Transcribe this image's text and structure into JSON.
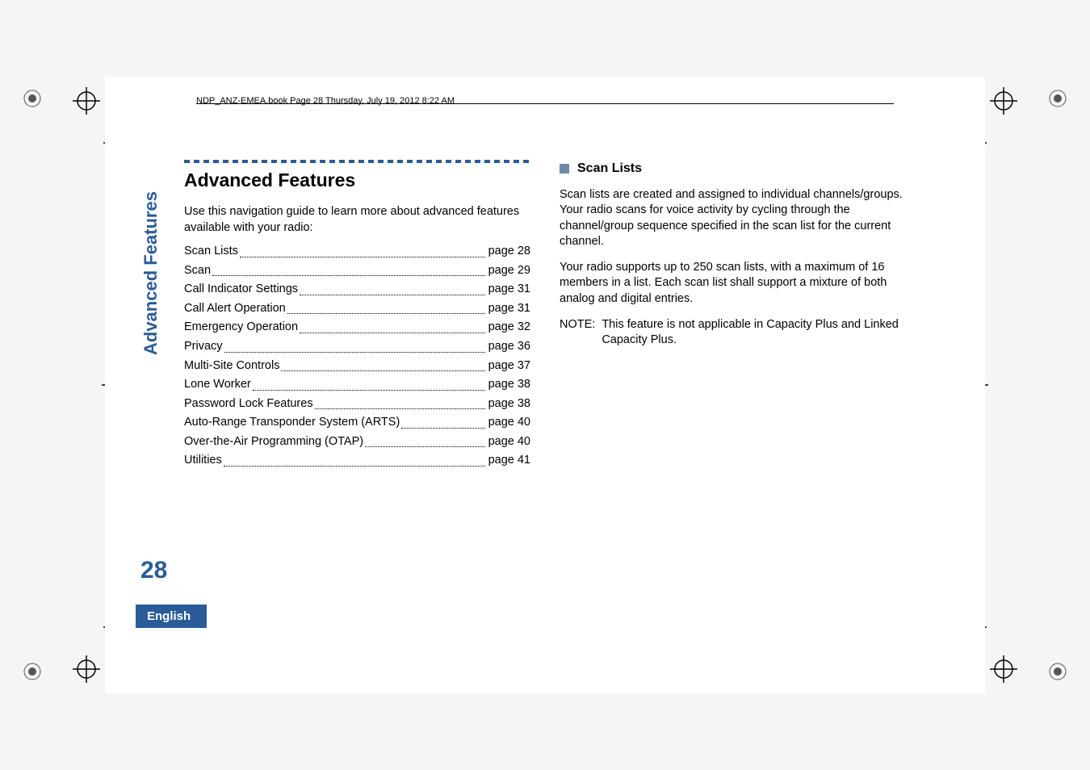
{
  "header": {
    "running_text": "NDP_ANZ-EMEA.book  Page 28  Thursday, July 19, 2012  8:22 AM"
  },
  "side": {
    "label": "Advanced Features",
    "page_number": "28",
    "language": "English"
  },
  "left": {
    "title": "Advanced Features",
    "intro": "Use this navigation guide to learn more about advanced features available with your radio:",
    "toc": [
      {
        "label": "Scan Lists",
        "page": "page 28"
      },
      {
        "label": "Scan",
        "page": "page 29"
      },
      {
        "label": "Call Indicator Settings",
        "page": "page 31"
      },
      {
        "label": "Call Alert Operation",
        "page": "page 31"
      },
      {
        "label": "Emergency Operation",
        "page": "page 32"
      },
      {
        "label": "Privacy",
        "page": "page 36"
      },
      {
        "label": "Multi-Site Controls",
        "page": "page 37"
      },
      {
        "label": "Lone Worker",
        "page": "page 38"
      },
      {
        "label": "Password Lock Features",
        "page": "page 38"
      },
      {
        "label": "Auto-Range Transponder System (ARTS)",
        "page": "page 40"
      },
      {
        "label": "Over-the-Air Programming (OTAP)",
        "page": "page 40"
      },
      {
        "label": "Utilities",
        "page": "page 41"
      }
    ]
  },
  "right": {
    "heading": "Scan Lists",
    "p1": "Scan lists are created and assigned to individual channels/groups. Your radio scans for voice activity by cycling through the channel/group sequence specified in the scan list for the current channel.",
    "p2": "Your radio supports up to 250 scan lists, with a maximum of 16 members in a list. Each scan list shall support a mixture of both analog and digital entries.",
    "note_label": "NOTE:",
    "note_body": "This feature is not applicable in Capacity Plus and Linked Capacity Plus."
  }
}
